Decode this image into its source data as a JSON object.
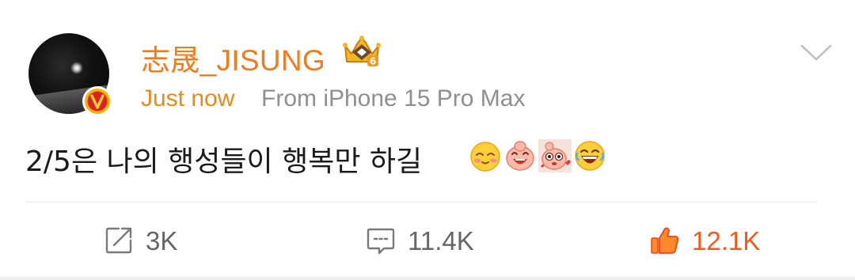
{
  "post": {
    "username": "志晟_JISUNG",
    "time": "Just now",
    "source": "From iPhone 15 Pro Max",
    "text": "2/5은 나의 행성들이 행복만 하길",
    "emoji_icons": [
      "shy-smile-emoji",
      "laughing-pig-emoji",
      "cute-pig-hearts-emoji",
      "grinning-tears-emoji"
    ],
    "badge_icon": "verified-v-badge",
    "rank_icon": "crown-level-6-badge",
    "rank_level": "6"
  },
  "actions": {
    "repost_count": "3K",
    "comment_count": "11.4K",
    "like_count": "12.1K"
  },
  "colors": {
    "username": "#f07c1f",
    "time": "#e98a1c",
    "source": "#8f8f8f",
    "like_accent": "#f05a1a",
    "icon_gray": "#7a7a7a"
  }
}
